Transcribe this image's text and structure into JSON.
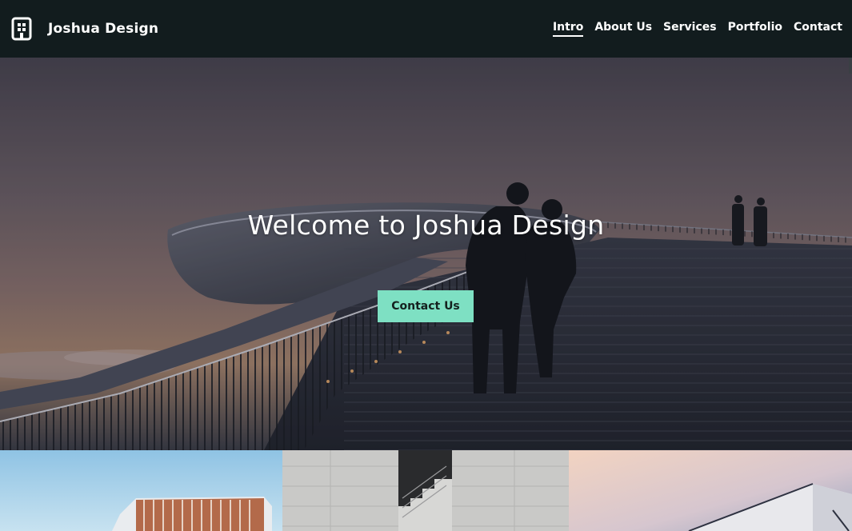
{
  "brand": {
    "name": "Joshua Design",
    "icon": "building-icon"
  },
  "nav": {
    "items": [
      {
        "label": "Intro",
        "active": true
      },
      {
        "label": "About Us",
        "active": false
      },
      {
        "label": "Services",
        "active": false
      },
      {
        "label": "Portfolio",
        "active": false
      },
      {
        "label": "Contact",
        "active": false
      }
    ]
  },
  "hero": {
    "title": "Welcome to Joshua Design",
    "cta_label": "Contact Us"
  },
  "colors": {
    "navbar_bg": "#121c1e",
    "accent": "#7ee0c3",
    "text": "#ffffff"
  },
  "gallery": {
    "images": [
      "modern-building-photo",
      "concrete-stairs-photo",
      "white-building-sunset-photo"
    ]
  }
}
